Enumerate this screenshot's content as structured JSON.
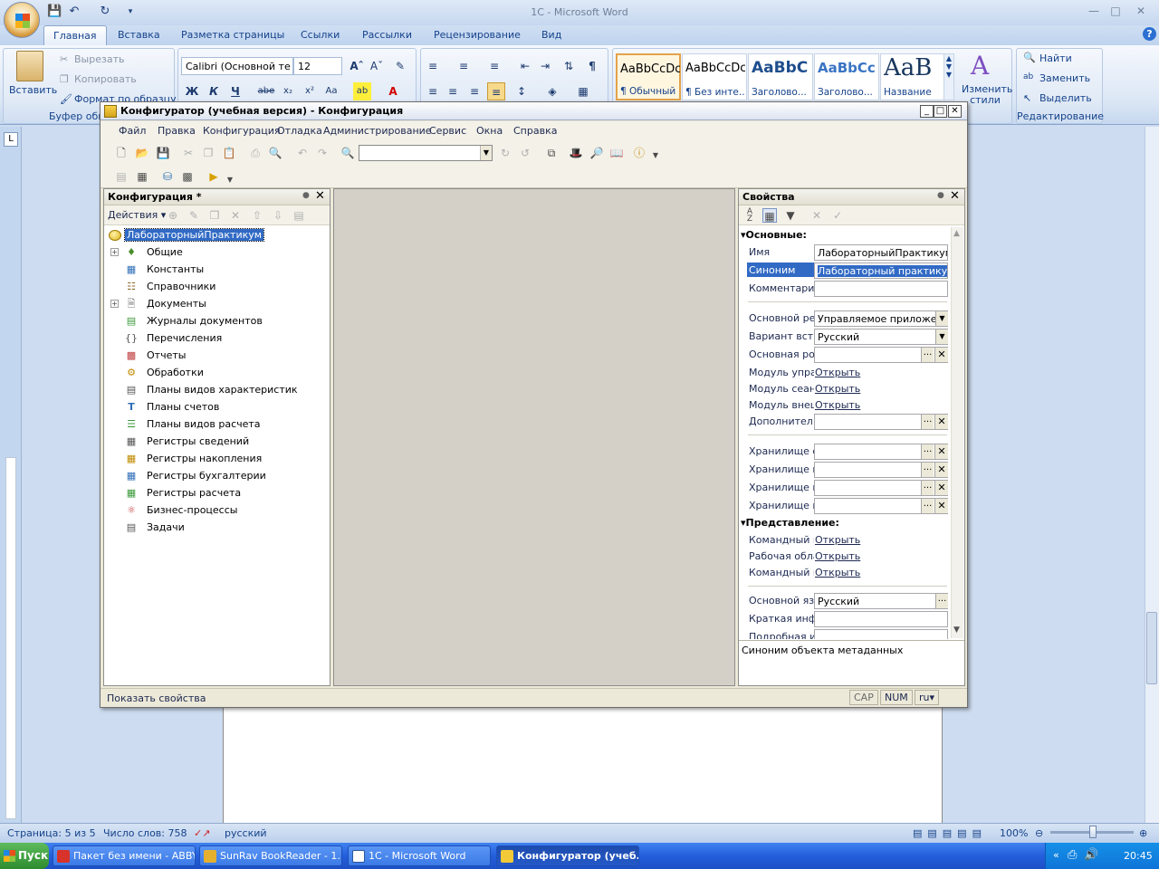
{
  "word": {
    "title": "1С - Microsoft Word",
    "tabs": [
      "Главная",
      "Вставка",
      "Разметка страницы",
      "Ссылки",
      "Рассылки",
      "Рецензирование",
      "Вид"
    ],
    "clipboard": {
      "paste": "Вставить",
      "cut": "Вырезать",
      "copy": "Копировать",
      "format": "Формат по образцу",
      "group": "Буфер обм"
    },
    "font": {
      "name": "Calibri (Основной те",
      "size": "12"
    },
    "styles": [
      {
        "sample": "AaBbCcDc",
        "name": "¶ Обычный"
      },
      {
        "sample": "AaBbCcDc",
        "name": "¶ Без инте..."
      },
      {
        "sample": "AaBbC",
        "name": "Заголово..."
      },
      {
        "sample": "AaBbCc",
        "name": "Заголово..."
      },
      {
        "sample": "AaB",
        "name": "Название"
      }
    ],
    "change_styles": "Изменить стили",
    "editing": {
      "find": "Найти",
      "replace": "Заменить",
      "select": "Выделить",
      "group": "Редактирование"
    },
    "status": {
      "page": "Страница: 5 из 5",
      "words": "Число слов: 758",
      "lang": "русский",
      "zoom": "100%"
    }
  },
  "c1": {
    "title": "Конфигуратор (учебная версия) - Конфигурация",
    "menu": [
      "Файл",
      "Правка",
      "Конфигурация",
      "Отладка",
      "Администрирование",
      "Сервис",
      "Окна",
      "Справка"
    ],
    "config_panel": {
      "title": "Конфигурация *",
      "actions": "Действия",
      "root": "ЛабораторныйПрактикум",
      "items": [
        {
          "label": "Общие",
          "expandable": true
        },
        {
          "label": "Константы"
        },
        {
          "label": "Справочники"
        },
        {
          "label": "Документы",
          "expandable": true
        },
        {
          "label": "Журналы документов"
        },
        {
          "label": "Перечисления"
        },
        {
          "label": "Отчеты"
        },
        {
          "label": "Обработки"
        },
        {
          "label": "Планы видов характеристик"
        },
        {
          "label": "Планы счетов"
        },
        {
          "label": "Планы видов расчета"
        },
        {
          "label": "Регистры сведений"
        },
        {
          "label": "Регистры накопления"
        },
        {
          "label": "Регистры бухгалтерии"
        },
        {
          "label": "Регистры расчета"
        },
        {
          "label": "Бизнес-процессы"
        },
        {
          "label": "Задачи"
        }
      ]
    },
    "props": {
      "title": "Свойства",
      "section_main": "Основные:",
      "section_view": "Представление:",
      "name_key": "Имя",
      "name_val": "ЛабораторныйПрактикум",
      "syn_key": "Синоним",
      "syn_val": "Лабораторный практикум",
      "comment_key": "Комментарий",
      "mode_key": "Основной реж",
      "mode_val": "Управляемое приложени",
      "variant_key": "Вариант встр",
      "variant_val": "Русский",
      "role_key": "Основная рол",
      "mod1_key": "Модуль управ",
      "mod2_key": "Модуль сеанс",
      "mod3_key": "Модуль внеш",
      "open": "Открыть",
      "extra_key": "Дополнител",
      "store1": "Хранилище о",
      "store2": "Хранилище п",
      "store3": "Хранилище в",
      "store4": "Хранилище н",
      "cmd1": "Командный и",
      "work": "Рабочая обла",
      "cmd2": "Командный и",
      "lang_key": "Основной язь",
      "lang_val": "Русский",
      "short_key": "Краткая инфс",
      "detail_key": "Подробная ин",
      "description": "Синоним объекта метаданных"
    },
    "status": {
      "text": "Показать свойства",
      "cap": "CAP",
      "num": "NUM",
      "lang": "ru"
    }
  },
  "taskbar": {
    "start": "Пуск",
    "tasks": [
      "Пакет без имени - ABBY...",
      "SunRav BookReader - 1...",
      "1С - Microsoft Word",
      "Конфигуратор (учеб..."
    ],
    "lang": "RU",
    "time": "20:45"
  }
}
